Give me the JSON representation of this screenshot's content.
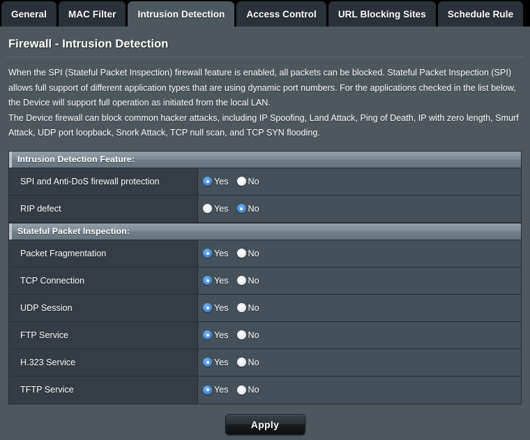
{
  "tabs": [
    {
      "label": "General",
      "active": false
    },
    {
      "label": "MAC Filter",
      "active": false
    },
    {
      "label": "Intrusion Detection",
      "active": true
    },
    {
      "label": "Access Control",
      "active": false
    },
    {
      "label": "URL Blocking Sites",
      "active": false
    },
    {
      "label": "Schedule Rule",
      "active": false
    }
  ],
  "page": {
    "title": "Firewall - Intrusion Detection",
    "description": [
      "When the SPI (Stateful Packet Inspection) firewall feature is enabled, all packets can be blocked. Stateful Packet Inspection (SPI) allows full support of different application types that are using dynamic port numbers.  For the applications checked in the list below, the Device will support full operation as initiated from the local LAN.",
      "The Device firewall can block common hacker attacks, including IP Spoofing, Land Attack, Ping of Death, IP with zero length, Smurf Attack, UDP port loopback, Snork Attack, TCP null scan, and TCP SYN flooding."
    ]
  },
  "radio_labels": {
    "yes": "Yes",
    "no": "No"
  },
  "sections": [
    {
      "header": "Intrusion Detection Feature:",
      "rows": [
        {
          "label": "SPI and Anti-DoS firewall protection",
          "value": "Yes"
        },
        {
          "label": "RIP defect",
          "value": "No"
        }
      ]
    },
    {
      "header": "Stateful Packet Inspection:",
      "rows": [
        {
          "label": "Packet Fragmentation",
          "value": "Yes"
        },
        {
          "label": "TCP Connection",
          "value": "Yes"
        },
        {
          "label": "UDP Session",
          "value": "Yes"
        },
        {
          "label": "FTP Service",
          "value": "Yes"
        },
        {
          "label": "H.323 Service",
          "value": "Yes"
        },
        {
          "label": "TFTP Service",
          "value": "Yes"
        }
      ]
    }
  ],
  "footer": {
    "apply_label": "Apply"
  },
  "colors": {
    "page_background": "#4d585e",
    "tabbar_background": "#000000",
    "tab_inactive": "#2b3138",
    "tab_active": "#4d585e",
    "row_label_background": "#343d45",
    "row_control_background": "#44505a",
    "section_header_accent": "#b9c3c9",
    "radio_selected": "#4c93dd",
    "border": "#262c31"
  }
}
